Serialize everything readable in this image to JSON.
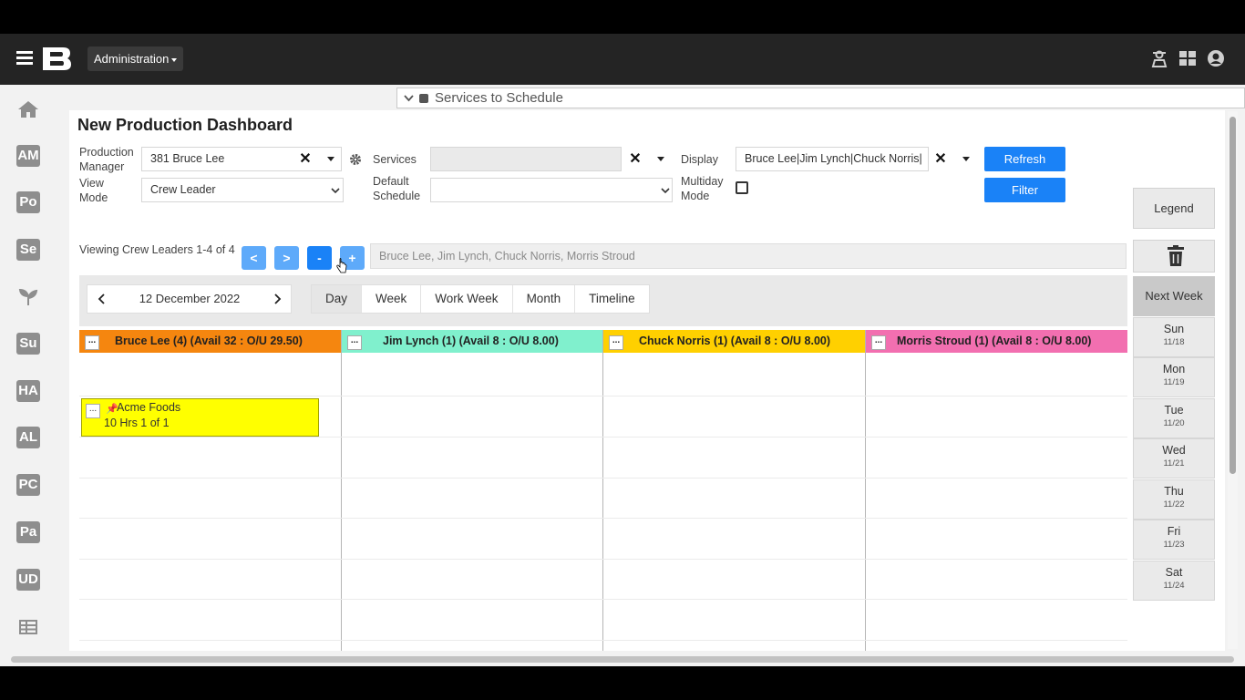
{
  "header": {
    "admin_menu": "Administration"
  },
  "sidebar": {
    "items": [
      "AM",
      "Po",
      "Se",
      "Su",
      "HA",
      "AL",
      "PC",
      "Pa",
      "UD"
    ]
  },
  "services_bar": {
    "label": "Services to Schedule"
  },
  "page": {
    "title": "New Production Dashboard"
  },
  "filters": {
    "production_manager_label": "Production Manager",
    "production_manager_value": "381 Bruce Lee",
    "view_mode_label": "View Mode",
    "view_mode_value": "Crew Leader",
    "services_label": "Services",
    "services_value": "",
    "default_schedule_label": "Default Schedule",
    "default_schedule_value": "",
    "display_label": "Display",
    "display_value": "Bruce Lee|Jim Lynch|Chuck Norris|",
    "multiday_label": "Multiday Mode",
    "refresh_label": "Refresh",
    "filter_label": "Filter",
    "viewing_text": "Viewing Crew Leaders 1-4 of 4",
    "prev_label": "<",
    "next_label": ">",
    "minus_label": "-",
    "plus_label": "+",
    "crew_list": "Bruce Lee, Jim Lynch, Chuck Norris, Morris Stroud"
  },
  "calendar": {
    "date": "12 December 2022",
    "views": [
      "Day",
      "Week",
      "Work Week",
      "Month",
      "Timeline"
    ],
    "active_view": "Day",
    "columns": [
      {
        "name": "Bruce Lee (4) (Avail 32 : O/U 29.50)",
        "color": "#f5860f"
      },
      {
        "name": "Jim Lynch (1) (Avail 8 : O/U 8.00)",
        "color": "#80f0cd"
      },
      {
        "name": "Chuck Norris (1) (Avail 8 : O/U 8.00)",
        "color": "#ffd000"
      },
      {
        "name": "Morris Stroud (1) (Avail 8 : O/U 8.00)",
        "color": "#f26fb0"
      }
    ],
    "column_menu": "...",
    "event": {
      "title": "Acme Foods",
      "detail": "10 Hrs 1 of 1",
      "color": "#ffff00"
    }
  },
  "right_panel": {
    "legend_label": "Legend",
    "next_week_label": "Next Week",
    "days": [
      {
        "day": "Sun",
        "date": "11/18"
      },
      {
        "day": "Mon",
        "date": "11/19"
      },
      {
        "day": "Tue",
        "date": "11/20"
      },
      {
        "day": "Wed",
        "date": "11/21"
      },
      {
        "day": "Thu",
        "date": "11/22"
      },
      {
        "day": "Fri",
        "date": "11/23"
      },
      {
        "day": "Sat",
        "date": "11/24"
      }
    ]
  }
}
